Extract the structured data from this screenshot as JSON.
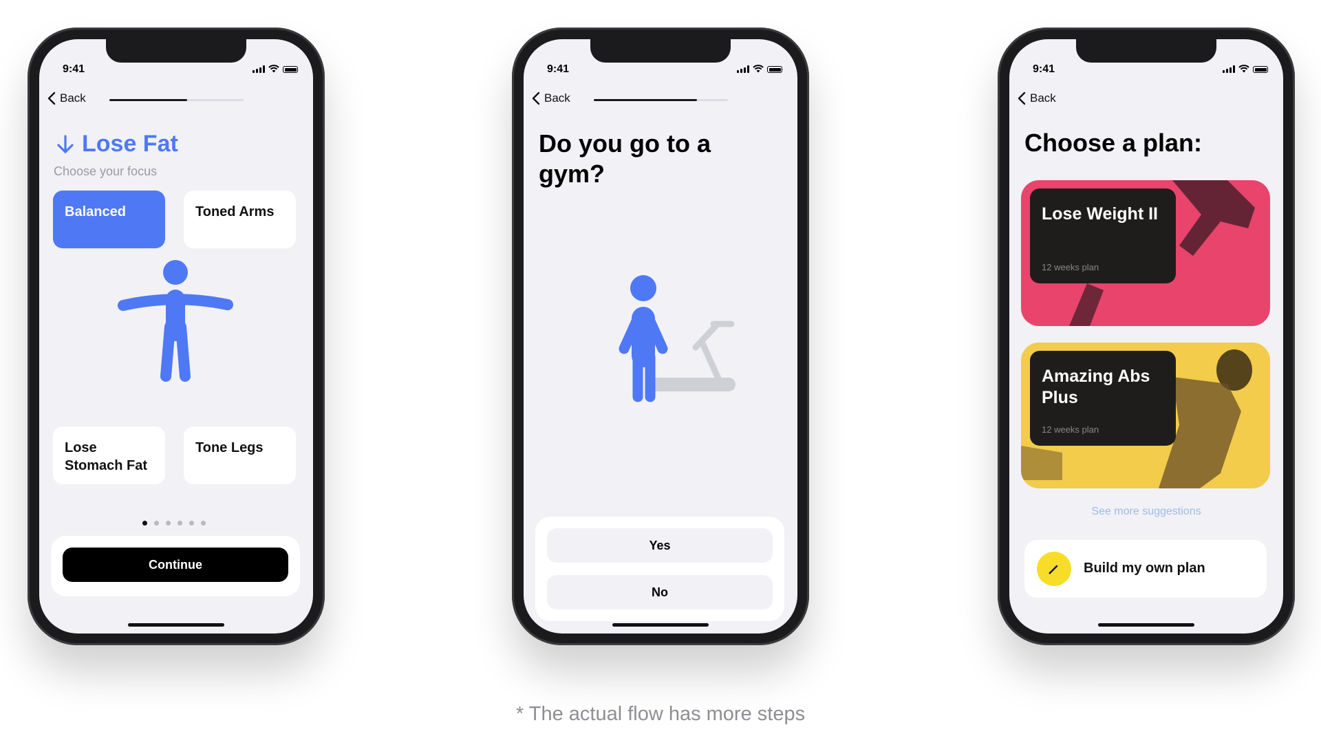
{
  "status_bar": {
    "time": "9:41"
  },
  "nav": {
    "back_label": "Back"
  },
  "screen1": {
    "progress": 0.58,
    "title": "Lose Fat",
    "subtitle": "Choose your focus",
    "options": [
      "Balanced",
      "Toned Arms",
      "Lose Stomach Fat",
      "Tone Legs"
    ],
    "selected_option": "Balanced",
    "page_dots": {
      "count": 6,
      "active": 1
    },
    "continue_label": "Continue",
    "accent_color": "#4f78f5"
  },
  "screen2": {
    "progress": 0.77,
    "question": "Do you go to a gym?",
    "answers": [
      "Yes",
      "No"
    ]
  },
  "screen3": {
    "title": "Choose a plan:",
    "plans": [
      {
        "name": "Lose Weight II",
        "duration": "12 weeks plan",
        "color": "#e8446c"
      },
      {
        "name": "Amazing Abs Plus",
        "duration": "12 weeks plan",
        "color": "#f2cc4a"
      }
    ],
    "see_more_label": "See more suggestions",
    "build_label": "Build my own plan",
    "build_icon": "pencil-icon"
  },
  "footnote": "* The actual flow has more steps"
}
